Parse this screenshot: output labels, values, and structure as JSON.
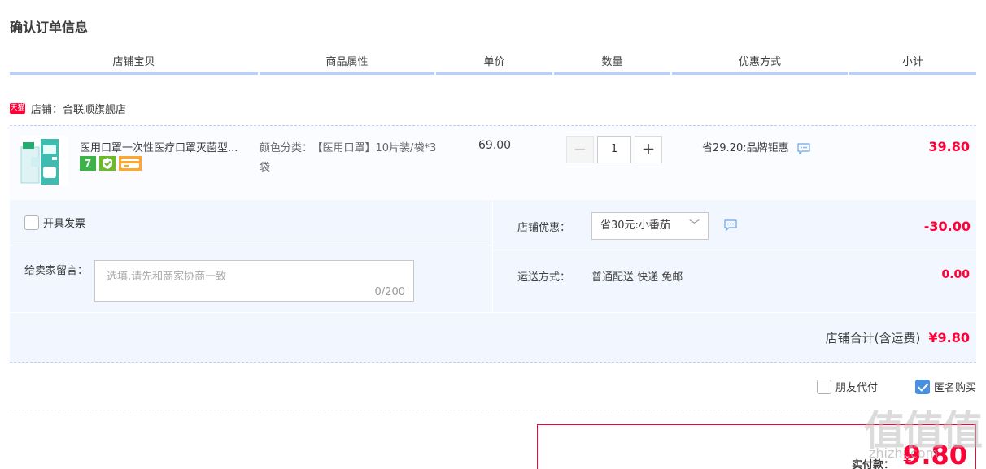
{
  "page": {
    "title": "确认订单信息"
  },
  "columns": [
    "店铺宝贝",
    "商品属性",
    "单价",
    "数量",
    "优惠方式",
    "小计"
  ],
  "shop": {
    "badge": "天猫",
    "name": "店铺：合联顺旗舰店"
  },
  "item": {
    "title": "医用口罩一次性医疗口罩灭菌型...",
    "badges": [
      "7",
      "shield",
      "card"
    ],
    "attr_key": "颜色分类：",
    "attr_value": "【医用口罩】10片装/袋*3袋",
    "unit_price": "69.00",
    "qty_minus": "−",
    "quantity": "1",
    "qty_plus": "+",
    "promo": "省29.20:品牌钜惠",
    "subtotal": "39.80"
  },
  "extras": {
    "invoice_label": "开具发票",
    "message_label": "给卖家留言：",
    "message_placeholder": "选填,请先和商家协商一致",
    "message_count": "0/200",
    "discount_label": "店铺优惠：",
    "discount_selected": "省30元:小番茄",
    "discount_chevron": "﹀",
    "discount_value": "-30.00",
    "shipping_label": "运送方式：",
    "shipping_method": "普通配送 快递 免邮",
    "shipping_value": "0.00"
  },
  "shop_total": {
    "label": "店铺合计(含运费)",
    "value": "¥9.80"
  },
  "options": [
    {
      "label": "朋友代付",
      "checked": false
    },
    {
      "label": "匿名购买",
      "checked": true
    }
  ],
  "payment": {
    "label": "实付款：",
    "yen": "¥",
    "amount": "9.80"
  },
  "watermark": {
    "main": "值值值",
    "sub": "zhizhi.com"
  },
  "colors": {
    "accent": "#ff0036",
    "header_rule": "#b2d1ff",
    "panel_bg": "#f2f7ff",
    "checkbox_checked": "#4a90e2"
  }
}
